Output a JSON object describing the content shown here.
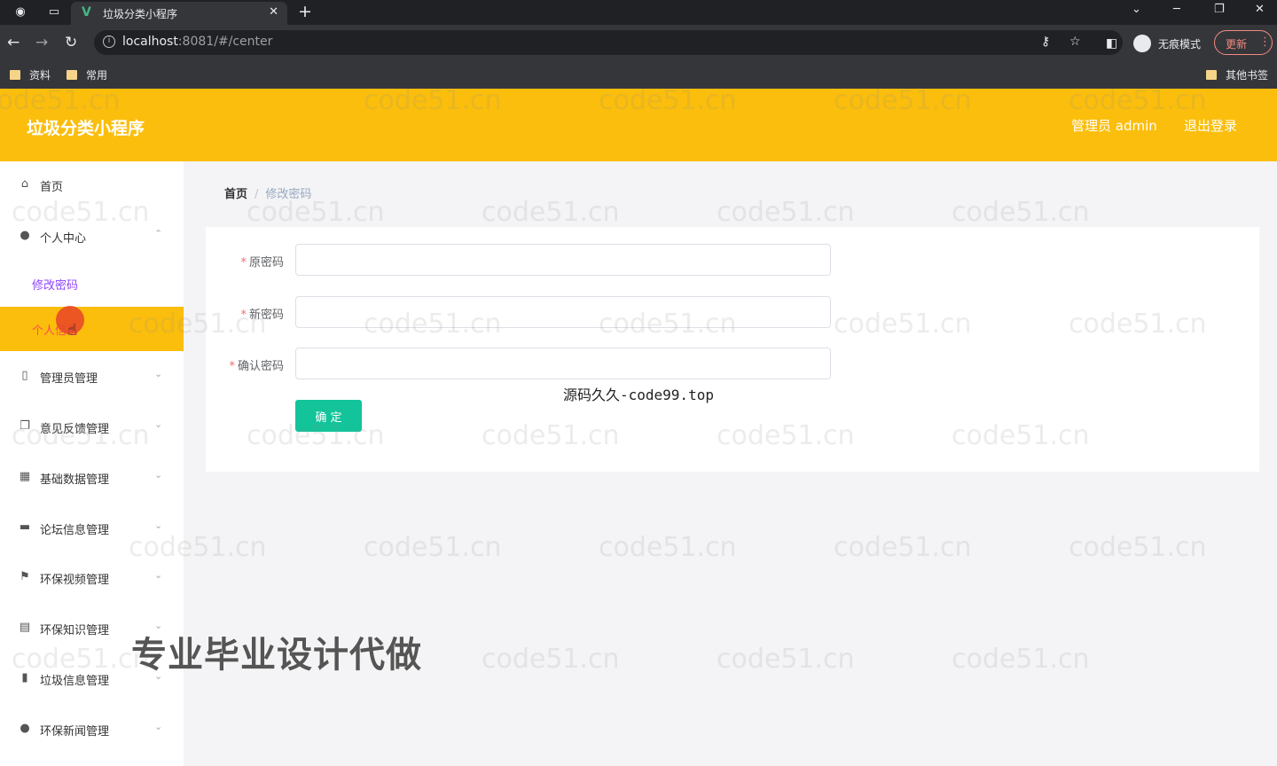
{
  "browser": {
    "tab_title": "垃圾分类小程序",
    "url_host": "localhost",
    "url_rest": ":8081/#/center",
    "incognito_label": "无痕模式",
    "update_label": "更新",
    "bookmarks": [
      "资料",
      "常用"
    ],
    "other_bookmarks": "其他书签"
  },
  "header": {
    "title": "垃圾分类小程序",
    "user_info": "管理员 admin",
    "logout": "退出登录"
  },
  "sidebar": {
    "home": "首页",
    "personal_center": "个人中心",
    "change_password": "修改密码",
    "personal_info": "个人信息",
    "admin_mgmt": "管理员管理",
    "feedback_mgmt": "意见反馈管理",
    "basic_data_mgmt": "基础数据管理",
    "forum_mgmt": "论坛信息管理",
    "video_mgmt": "环保视频管理",
    "knowledge_mgmt": "环保知识管理",
    "garbage_mgmt": "垃圾信息管理",
    "news_mgmt": "环保新闻管理"
  },
  "breadcrumb": {
    "home": "首页",
    "separator": "/",
    "current": "修改密码"
  },
  "form": {
    "required_mark": "*",
    "old_password_label": "原密码",
    "new_password_label": "新密码",
    "confirm_password_label": "确认密码",
    "old_password_value": "",
    "new_password_value": "",
    "confirm_password_value": "",
    "submit_label": "确 定"
  },
  "overlays": {
    "watermark": "code51.cn",
    "source_text": "源码久久-code99.top",
    "promo_text": "专业毕业设计代做"
  }
}
